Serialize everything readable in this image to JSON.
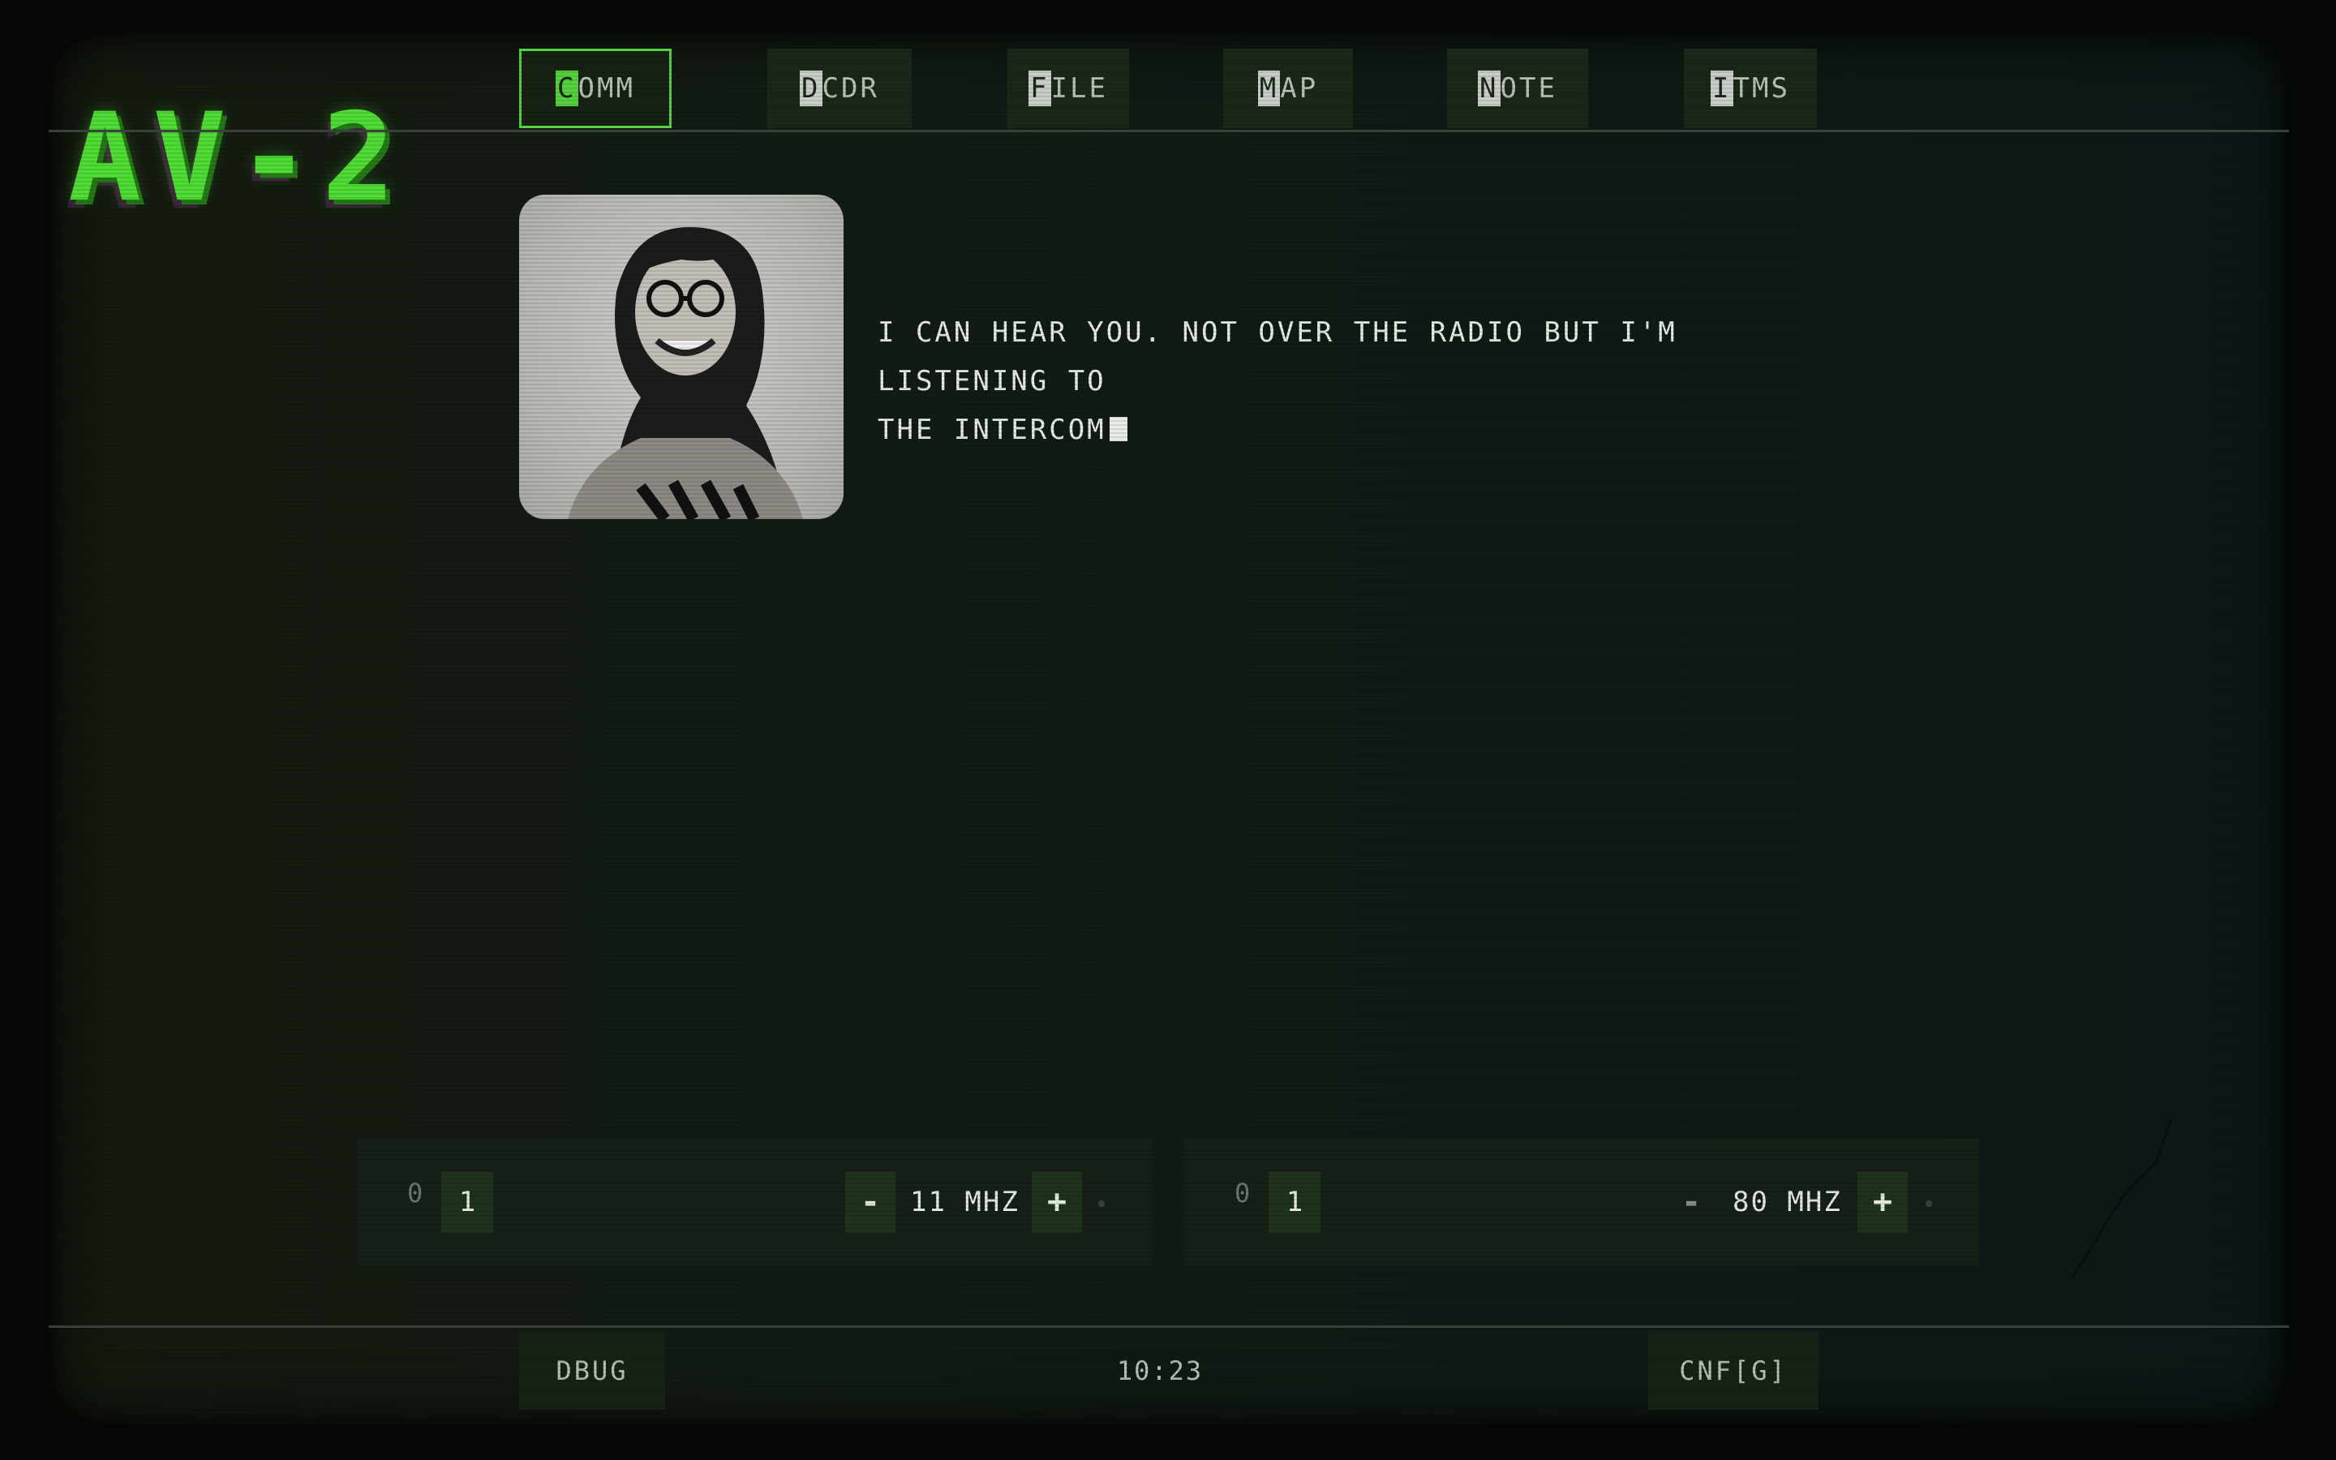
{
  "logo": "AV-2",
  "tabs": [
    {
      "hot": "C",
      "rest": "OMM",
      "active": true
    },
    {
      "hot": "D",
      "rest": "CDR",
      "active": false
    },
    {
      "hot": "F",
      "rest": "ILE",
      "active": false
    },
    {
      "hot": "M",
      "rest": "AP",
      "active": false
    },
    {
      "hot": "N",
      "rest": "OTE",
      "active": false
    },
    {
      "hot": "I",
      "rest": "TMS",
      "active": false
    }
  ],
  "message": {
    "line1": "I CAN HEAR YOU. NOT OVER THE RADIO BUT I'M LISTENING TO",
    "line2": "THE INTERCOM"
  },
  "channels": [
    {
      "bit_off": "0",
      "bit_on": "1",
      "minus": "-",
      "freq": "11 MHZ",
      "plus": "+"
    },
    {
      "bit_off": "0",
      "bit_on": "1",
      "minus": "-",
      "freq": "80 MHZ",
      "plus": "+"
    }
  ],
  "footer": {
    "debug_label": "DBUG",
    "clock": "10:23",
    "config_label": "CNF[G]"
  },
  "colors": {
    "accent": "#55d13f",
    "text": "#e8ece6",
    "panel": "#162017"
  }
}
